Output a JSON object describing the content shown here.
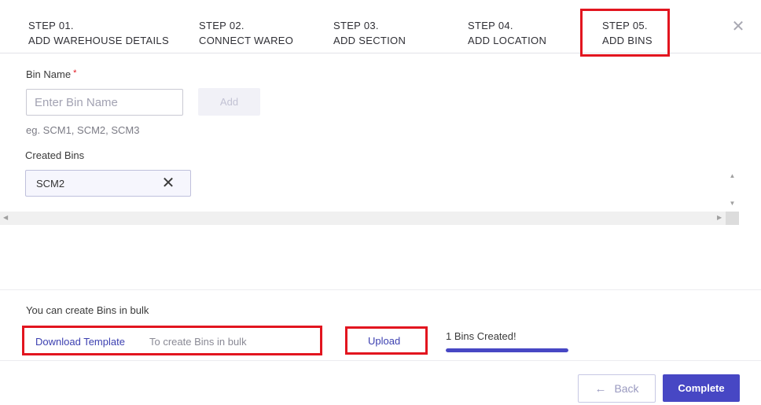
{
  "steps": [
    {
      "num": "STEP 01.",
      "label": "ADD WAREHOUSE DETAILS"
    },
    {
      "num": "STEP 02.",
      "label": "CONNECT WAREO"
    },
    {
      "num": "STEP 03.",
      "label": "ADD SECTION"
    },
    {
      "num": "STEP 04.",
      "label": "ADD LOCATION"
    },
    {
      "num": "STEP 05.",
      "label": "ADD BINS"
    }
  ],
  "close_icon": "close-icon",
  "form": {
    "bin_name_label": "Bin Name",
    "required_mark": "*",
    "bin_name_placeholder": "Enter Bin Name",
    "bin_name_value": "",
    "add_label": "Add",
    "hint": "eg. SCM1, SCM2, SCM3",
    "created_bins_label": "Created Bins",
    "created_bins": [
      "SCM2"
    ]
  },
  "bulk": {
    "title": "You can create Bins in bulk",
    "download_label": "Download Template",
    "download_desc": "To create Bins in bulk",
    "upload_label": "Upload",
    "created_status": "1 Bins Created!",
    "progress": 1.0
  },
  "footer": {
    "back_label": "Back",
    "complete_label": "Complete"
  },
  "colors": {
    "accent": "#4747c4",
    "highlight": "#e2151f"
  }
}
